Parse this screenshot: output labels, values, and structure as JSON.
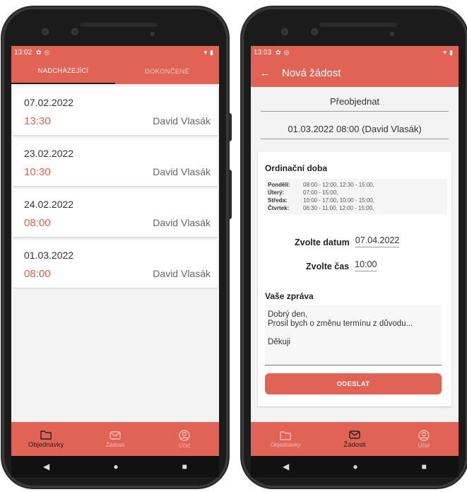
{
  "left_phone": {
    "status_time": "13:02",
    "tabs": [
      {
        "label": "NADCHÁZEJÍCÍ"
      },
      {
        "label": "DOKONČENÉ"
      }
    ],
    "appointments": [
      {
        "date": "07.02.2022",
        "time": "13:30",
        "doctor": "David Vlasák"
      },
      {
        "date": "23.02.2022",
        "time": "10:30",
        "doctor": "David Vlasák"
      },
      {
        "date": "24.02.2022",
        "time": "08:00",
        "doctor": "David Vlasák"
      },
      {
        "date": "01.03.2022",
        "time": "08:00",
        "doctor": "David Vlasák"
      }
    ],
    "nav": [
      {
        "label": "Objednávky",
        "icon": "folder-icon"
      },
      {
        "label": "Žádosti",
        "icon": "mail-icon"
      },
      {
        "label": "Účet",
        "icon": "user-icon"
      }
    ]
  },
  "right_phone": {
    "status_time": "13:03",
    "appbar_title": "Nová žádost",
    "reorder_label": "Přeobjednat",
    "selected_appointment": "01.03.2022 08:00 (David Vlasák)",
    "office_hours_title": "Ordinační doba",
    "office_hours": [
      {
        "day": "Pondělí:",
        "hours": "08:00 - 12:00, 12:30 - 15:00,"
      },
      {
        "day": "Úterý:",
        "hours": "07:00 - 15:00,"
      },
      {
        "day": "Středa:",
        "hours": "10:00 - 17:00, 10:00 - 15:00,"
      },
      {
        "day": "Čtvrtek:",
        "hours": "06:30 - 11:00, 12:00 - 15:00,"
      }
    ],
    "date_label": "Zvolte datum",
    "date_value": "07.04.2022",
    "time_label": "Zvolte čas",
    "time_value": "10:00",
    "message_title": "Vaše zpráva",
    "message_lines": [
      "Dobrý den,",
      "Prosil bych o změnu termínu z důvodu...",
      "",
      "Děkuji"
    ],
    "send_label": "ODESLAT",
    "nav": [
      {
        "label": "Objednávky",
        "icon": "folder-icon"
      },
      {
        "label": "Žádosti",
        "icon": "mail-icon"
      },
      {
        "label": "Účet",
        "icon": "user-icon"
      }
    ]
  },
  "colors": {
    "accent": "#e06356",
    "active_nav": "#222222"
  }
}
